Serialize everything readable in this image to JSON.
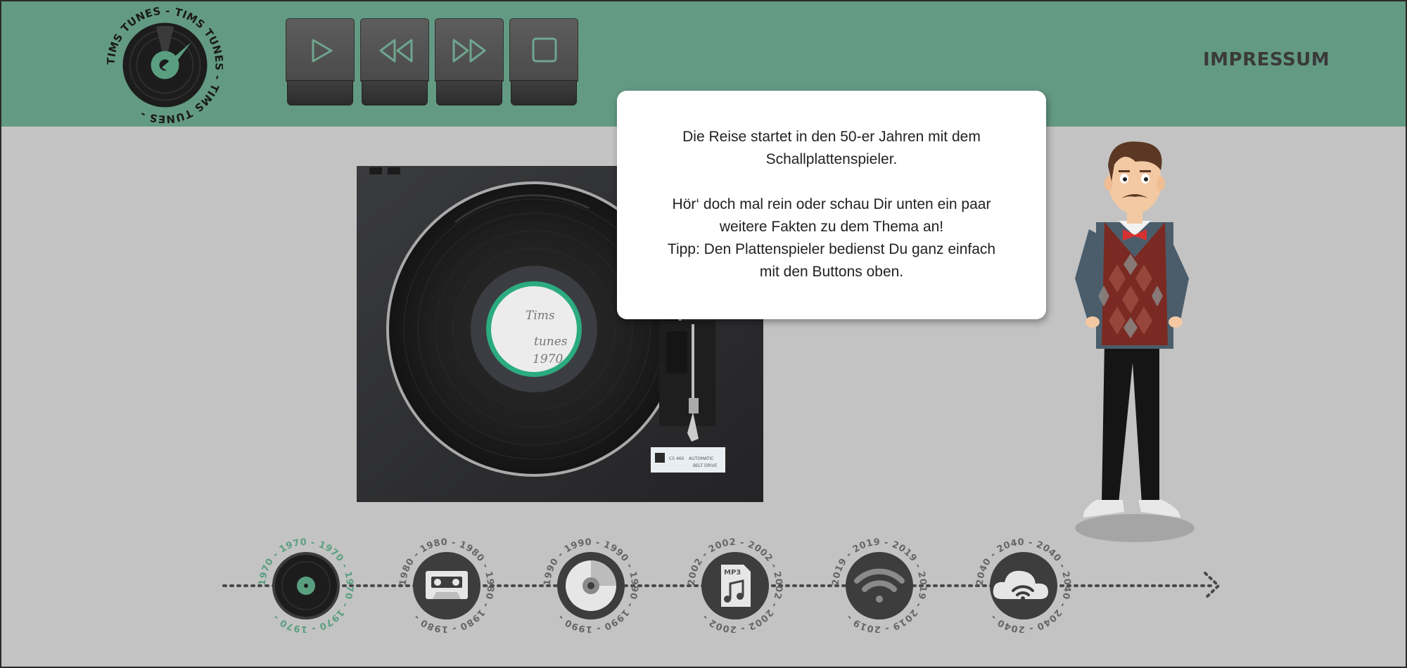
{
  "header": {
    "logo_text": "TIMS TUNES - TIMS TUNES - TIMS TUNES -",
    "impressum_label": "IMPRESSUM",
    "bg_color": "#639a84"
  },
  "controls": [
    {
      "name": "play",
      "icon": "play-icon"
    },
    {
      "name": "rewind",
      "icon": "rewind-icon"
    },
    {
      "name": "fast-forward",
      "icon": "fast-forward-icon"
    },
    {
      "name": "stop",
      "icon": "stop-icon"
    }
  ],
  "speech_bubble": {
    "line1": "Die Reise startet in den 50-er Jahren mit dem",
    "line2": "Schallplattenspieler.",
    "line3": "Hör‘ doch mal rein oder schau Dir unten ein paar",
    "line4": "weitere Fakten zu dem Thema an!",
    "line5": "Tipp: Den Plattenspieler bedienst Du ganz einfach",
    "line6": "mit den Buttons oben."
  },
  "record_label": {
    "line1": "Tims",
    "line2": "tunes",
    "line3": "1970"
  },
  "turntable_plate": {
    "line1": "AUTOMATIC",
    "line2": "BELT DRIVE",
    "model": "CS 460"
  },
  "timeline": {
    "eras": [
      {
        "year": "1970",
        "icon": "vinyl-record-icon",
        "ring_text": "1970 - 1970 - 1970 - 1970 - 1970 - 1970 -",
        "active": true
      },
      {
        "year": "1980",
        "icon": "cassette-icon",
        "ring_text": "1980 - 1980 - 1980 - 1980 - 1980 - 1980 -",
        "active": false
      },
      {
        "year": "1990",
        "icon": "cd-icon",
        "ring_text": "1990 - 1990 - 1990 - 1990 - 1990 - 1990 -",
        "active": false
      },
      {
        "year": "2002",
        "icon": "mp3-file-icon",
        "ring_text": "2002 - 2002 - 2002 - 2002 - 2002 - 2002 -",
        "active": false
      },
      {
        "year": "2019",
        "icon": "wifi-icon",
        "ring_text": "2019 - 2019 - 2019 - 2019 - 2019 - 2019 -",
        "active": false
      },
      {
        "year": "2040",
        "icon": "cloud-wifi-icon",
        "ring_text": "2040 - 2040 - 2040 - 2040 - 2040 - 2040 -",
        "active": false
      }
    ],
    "mp3_label": "MP3",
    "active_color": "#5a9e80",
    "inactive_color": "#666666"
  }
}
